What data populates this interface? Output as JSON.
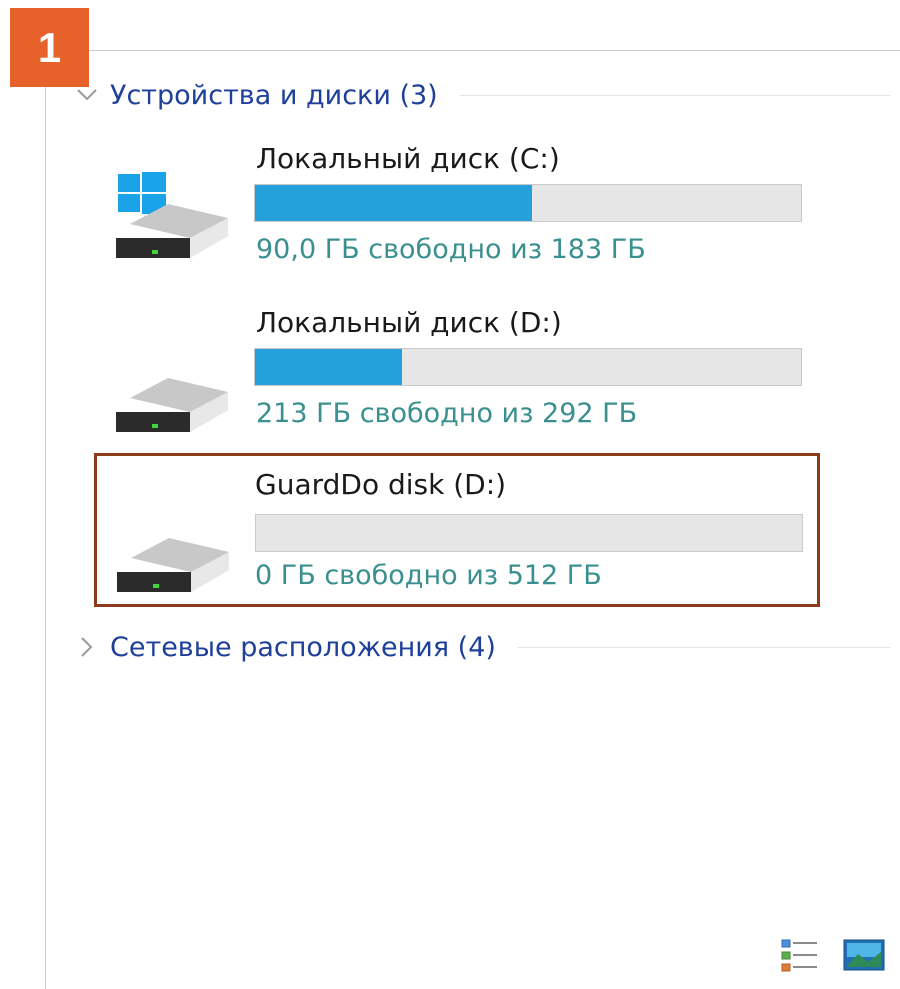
{
  "step_number": "1",
  "groups": {
    "devices": {
      "title": "Устройства и диски (3)"
    },
    "network": {
      "title": "Сетевые расположения (4)"
    }
  },
  "drives": [
    {
      "name": "Локальный диск (C:)",
      "space_text": "90,0 ГБ свободно из 183 ГБ",
      "used_fraction": 0.508,
      "icon": "windows-system-drive-icon"
    },
    {
      "name": "Локальный диск (D:)",
      "space_text": "213 ГБ свободно из 292 ГБ",
      "used_fraction": 0.27,
      "icon": "hard-drive-icon"
    },
    {
      "name": "GuardDo disk (D:)",
      "space_text": "0 ГБ свободно из 512 ГБ",
      "used_fraction": 0,
      "icon": "hard-drive-icon"
    }
  ],
  "colors": {
    "accent": "#e6622a",
    "usage_fill": "#26a0da",
    "group_title": "#1e3f9a",
    "space_text": "#3a8f8f",
    "selection_border": "#8b3a1a"
  },
  "view_icons": [
    "details-view-icon",
    "tiles-view-icon"
  ]
}
